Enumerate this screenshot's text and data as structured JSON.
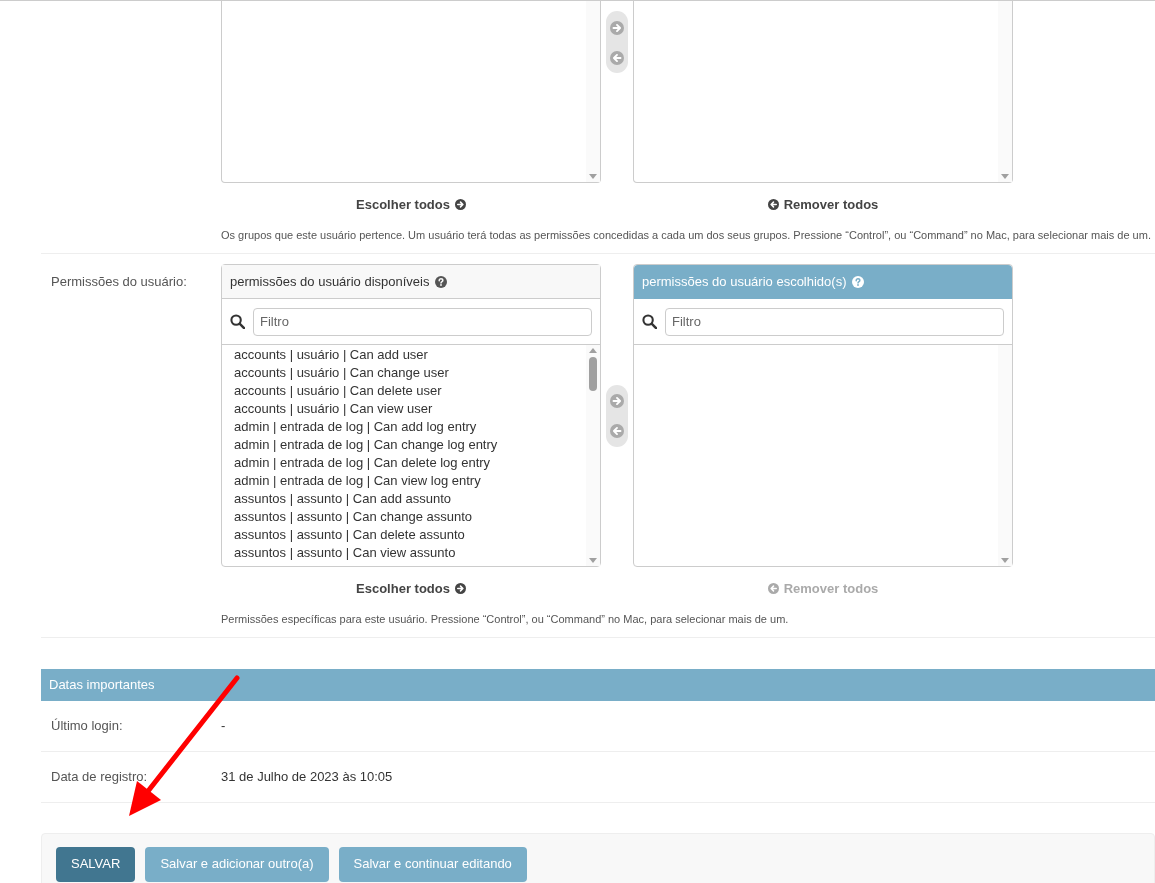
{
  "group_selector": {
    "choose_all": {
      "label": "Escolher todos",
      "disabled": false
    },
    "remove_all": {
      "label": "Remover todos",
      "disabled": false
    },
    "help": "Os grupos que este usuário pertence. Um usuário terá todas as permissões concedidas a cada um dos seus grupos. Pressione “Control”, ou “Command” no Mac, para selecionar mais de um."
  },
  "permissions": {
    "label": "Permissões do usuário:",
    "available_title": "permissões do usuário disponíveis",
    "chosen_title": "permissões do usuário escolhido(s)",
    "available_filter": {
      "placeholder": "Filtro"
    },
    "chosen_filter": {
      "placeholder": "Filtro"
    },
    "available_items": [
      "accounts | usuário | Can add user",
      "accounts | usuário | Can change user",
      "accounts | usuário | Can delete user",
      "accounts | usuário | Can view user",
      "admin | entrada de log | Can add log entry",
      "admin | entrada de log | Can change log entry",
      "admin | entrada de log | Can delete log entry",
      "admin | entrada de log | Can view log entry",
      "assuntos | assunto | Can add assunto",
      "assuntos | assunto | Can change assunto",
      "assuntos | assunto | Can delete assunto",
      "assuntos | assunto | Can view assunto"
    ],
    "choose_all": {
      "label": "Escolher todos",
      "disabled": false
    },
    "remove_all": {
      "label": "Remover todos",
      "disabled": true
    },
    "help": "Permissões específicas para este usuário. Pressione “Control”, ou “Command” no Mac, para selecionar mais de um."
  },
  "dates_section": {
    "title": "Datas importantes",
    "rows": [
      {
        "label": "Último login:",
        "value": "-"
      },
      {
        "label": "Data de registro:",
        "value": "31 de Julho de 2023 às 10:05"
      }
    ]
  },
  "submit_row": {
    "buttons": [
      {
        "label": "SALVAR",
        "kind": "default"
      },
      {
        "label": "Salvar e adicionar outro(a)",
        "kind": "secondary"
      },
      {
        "label": "Salvar e continuar editando",
        "kind": "secondary"
      }
    ]
  }
}
